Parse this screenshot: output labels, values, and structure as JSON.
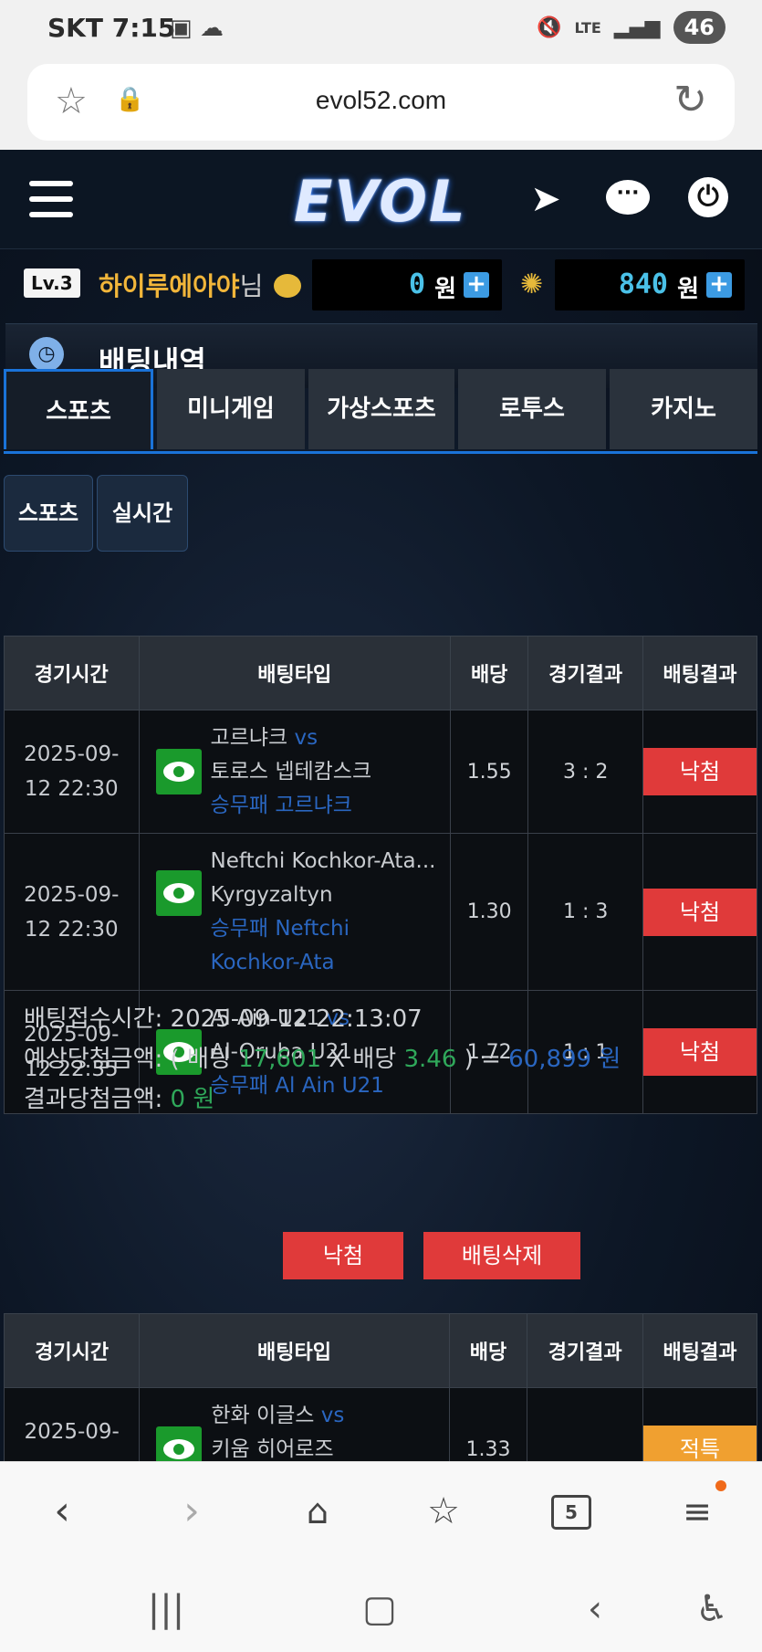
{
  "status": {
    "carrier": "SKT",
    "time": "7:15",
    "net": "LTE",
    "battery": "46"
  },
  "browser": {
    "url": "evol52.com",
    "tab_count": "5"
  },
  "header": {
    "logo": "EVOL"
  },
  "user": {
    "level": "Lv.3",
    "name": "하이루에아야",
    "suffix": "님",
    "money1": "0",
    "money2": "840",
    "currency": "원",
    "plus": "+"
  },
  "title": "배팅내역",
  "tabs": [
    "스포츠",
    "미니게임",
    "가상스포츠",
    "로투스",
    "카지노"
  ],
  "subtabs": [
    "스포츠",
    "실시간"
  ],
  "table": {
    "headers": [
      "경기시간",
      "배팅타입",
      "배당",
      "경기결과",
      "배팅결과"
    ],
    "rows": [
      {
        "date": "2025-09-",
        "time": "12 22:30",
        "home": "고르냐크",
        "vs": "vs",
        "away": "토로스 넵테캄스크",
        "pick": "승무패 고르냐크",
        "pick2": "",
        "odds": "1.55",
        "score": "3 : 2",
        "result": "낙첨"
      },
      {
        "date": "2025-09-",
        "time": "12 22:30",
        "home": "Neftchi Kochkor-Ata...",
        "vs": "",
        "away": "Kyrgyzaltyn",
        "pick": "승무패 Neftchi",
        "pick2": "Kochkor-Ata",
        "odds": "1.30",
        "score": "1 : 3",
        "result": "낙첨"
      },
      {
        "date": "2025-09-",
        "time": "12 22:35",
        "home": "Al Ain U21",
        "vs": "vs",
        "away": "Al-Oruba U21",
        "pick": "승무패 Al Ain U21",
        "pick2": "",
        "odds": "1.72",
        "score": "1 : 1",
        "result": "낙첨"
      }
    ]
  },
  "summary": {
    "received_label": "배팅접수시간:",
    "received_value": "2025-09-12 22:13:07",
    "expected_label": "예상당첨금액:",
    "paren_open": "( 배팅",
    "bet_amount": "17,601",
    "x_odds": "X 배당",
    "total_odds": "3.46",
    "paren_close": ") =",
    "expected_amount": "60,899 원",
    "result_label": "결과당첨금액:",
    "result_amount": "0 원",
    "status_btn": "낙첨",
    "delete_btn": "배팅삭제"
  },
  "table2": {
    "headers": [
      "경기시간",
      "배팅타입",
      "배당",
      "경기결과",
      "배팅결과"
    ],
    "row": {
      "date": "2025-09-",
      "home": "한화 이글스",
      "vs": "vs",
      "away": "키움 히어로즈",
      "odds": "1.33",
      "result": "적특"
    }
  },
  "icons": {
    "star": "star-icon",
    "lock": "lock-icon",
    "reload": "reload-icon",
    "menu": "hamburger-icon",
    "telegram": "telegram-icon",
    "chat": "chat-icon",
    "power": "power-icon",
    "coin": "coin-icon",
    "chip": "chip-icon",
    "clock": "history-icon",
    "eye": "eye-icon"
  },
  "colors": {
    "accent": "#1a73d9",
    "lose": "#e03a3a",
    "special": "#f0a030",
    "user": "#f2b63a",
    "money": "#4ac1e8"
  }
}
